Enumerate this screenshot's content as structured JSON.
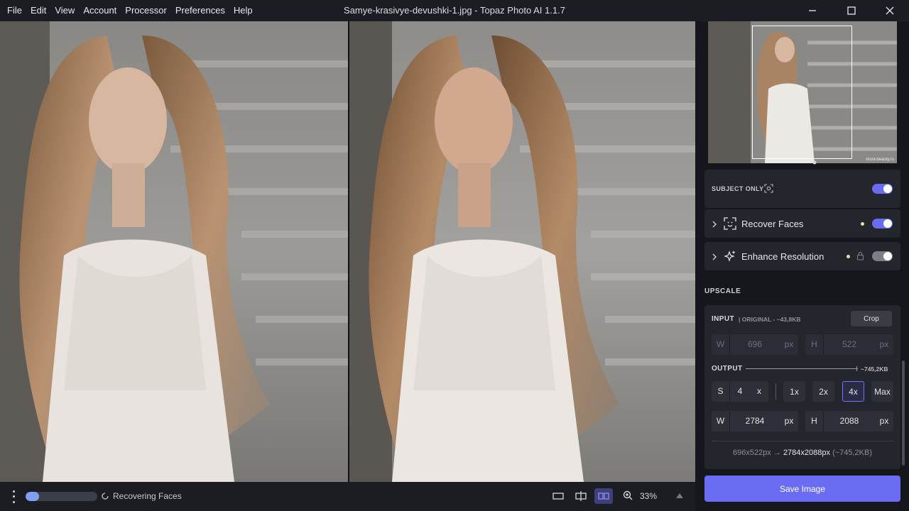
{
  "menu": [
    "File",
    "Edit",
    "View",
    "Account",
    "Processor",
    "Preferences",
    "Help"
  ],
  "window_title": "Samye-krasivye-devushki-1.jpg - Topaz Photo AI 1.1.7",
  "navigator": {
    "watermark": "most-beauty.ru"
  },
  "subject_only": {
    "label": "SUBJECT ONLY",
    "enabled": true
  },
  "recover_faces": {
    "label": "Recover Faces",
    "enabled": true
  },
  "enhance_resolution": {
    "label": "Enhance Resolution",
    "enabled": true
  },
  "upscale": {
    "section_title": "UPSCALE",
    "input_label": "INPUT",
    "input_meta": "| ORIGINAL - ~43,8KB",
    "crop_label": "Crop",
    "input_w": {
      "label": "W",
      "value": "696",
      "unit": "px"
    },
    "input_h": {
      "label": "H",
      "value": "522",
      "unit": "px"
    },
    "output_label": "OUTPUT",
    "output_size": "~745,2KB",
    "scale": {
      "label": "S",
      "value": "4",
      "unit": "x"
    },
    "scale_buttons": [
      "1x",
      "2x",
      "4x",
      "Max"
    ],
    "selected_scale": "4x",
    "output_w": {
      "label": "W",
      "value": "2784",
      "unit": "px"
    },
    "output_h": {
      "label": "H",
      "value": "2088",
      "unit": "px"
    },
    "summary_from": "696x522px →",
    "summary_to": "2784x2088px",
    "summary_size": "(~745,2KB)"
  },
  "save_label": "Save Image",
  "status": {
    "text": "Recovering Faces",
    "progress": 0.19
  },
  "zoom": "33%",
  "colors": {
    "accent": "#6b6cf4",
    "panel": "#23262d",
    "background": "#15171d"
  }
}
